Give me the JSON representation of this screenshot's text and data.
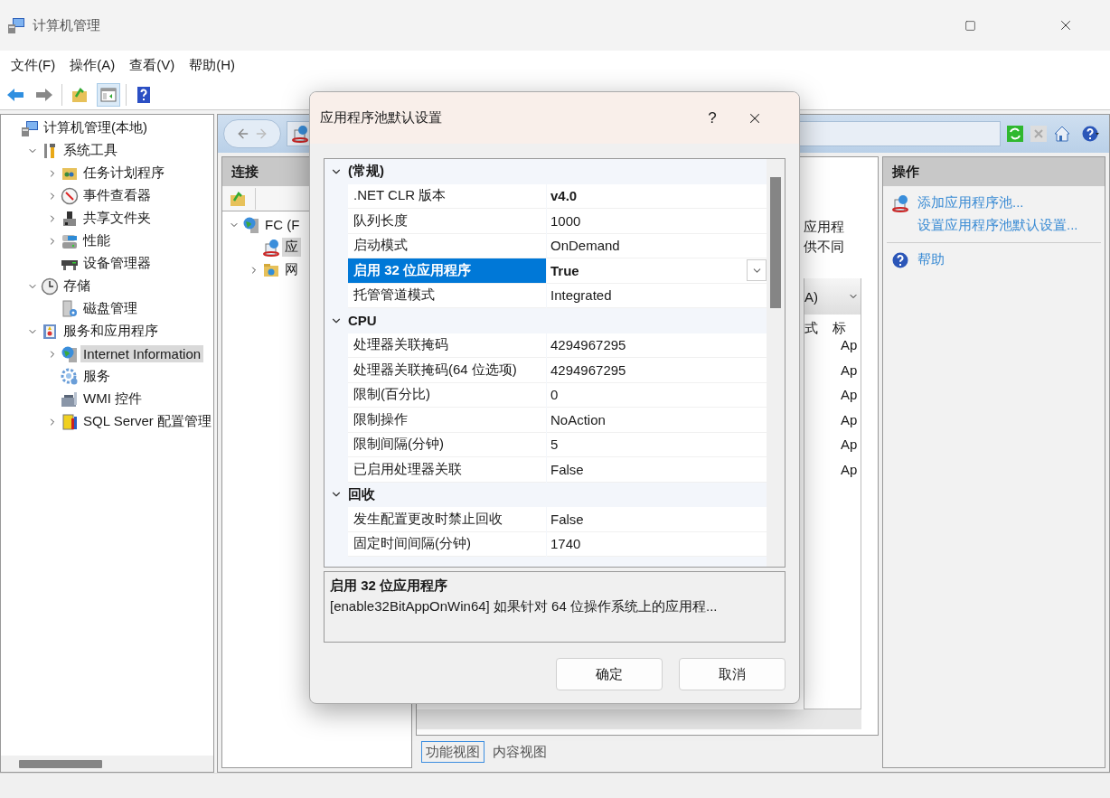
{
  "window": {
    "title": "计算机管理"
  },
  "menu": [
    "文件(F)",
    "操作(A)",
    "查看(V)",
    "帮助(H)"
  ],
  "tree": [
    {
      "label": "计算机管理(本地)",
      "selected": false,
      "children": [
        {
          "label": "系统工具",
          "selected": false,
          "expanded": true,
          "children": [
            {
              "label": "任务计划程序",
              "selected": false,
              "expanded": false
            },
            {
              "label": "事件查看器",
              "selected": false,
              "expanded": false
            },
            {
              "label": "共享文件夹",
              "selected": false,
              "expanded": false
            },
            {
              "label": "性能",
              "selected": false,
              "expanded": false
            },
            {
              "label": "设备管理器",
              "selected": false
            }
          ]
        },
        {
          "label": "存储",
          "selected": false,
          "expanded": true,
          "children": [
            {
              "label": "磁盘管理",
              "selected": false
            }
          ]
        },
        {
          "label": "服务和应用程序",
          "selected": false,
          "expanded": true,
          "children": [
            {
              "label": "Internet Information",
              "selected": true,
              "expanded": false
            },
            {
              "label": "服务",
              "selected": false
            },
            {
              "label": "WMI 控件",
              "selected": false
            },
            {
              "label": "SQL Server 配置管理",
              "selected": false,
              "expanded": false
            }
          ]
        }
      ]
    }
  ],
  "connections": {
    "title": "连接",
    "tree": [
      {
        "label": "FC (F",
        "selected": false,
        "expanded": true,
        "children": [
          {
            "label": "应",
            "selected": true
          },
          {
            "label": "网",
            "selected": false,
            "expanded": false
          }
        ]
      }
    ]
  },
  "center": {
    "description_fragments": [
      "应用程",
      "供不同"
    ],
    "column_headers": [
      "A)",
      "式",
      "标"
    ],
    "rows": [
      "Ap",
      "Ap",
      "Ap",
      "Ap",
      "Ap",
      "Ap"
    ],
    "view_tabs": [
      {
        "label": "功能视图",
        "selected": true
      },
      {
        "label": "内容视图",
        "selected": false
      }
    ]
  },
  "actions": {
    "title": "操作",
    "groups": [
      [
        "添加应用程序池...",
        "设置应用程序池默认设置..."
      ],
      [
        "帮助"
      ]
    ]
  },
  "dialog": {
    "title": "应用程序池默认设置",
    "help_button": "?",
    "categories": [
      {
        "name": "(常规)",
        "expanded": true,
        "rows": [
          {
            "name": ".NET CLR 版本",
            "value": "v4.0",
            "modified": true,
            "selected": false
          },
          {
            "name": "队列长度",
            "value": "1000",
            "modified": false,
            "selected": false
          },
          {
            "name": "启动模式",
            "value": "OnDemand",
            "modified": false,
            "selected": false
          },
          {
            "name": "启用 32 位应用程序",
            "value": "True",
            "modified": true,
            "selected": true
          },
          {
            "name": "托管管道模式",
            "value": "Integrated",
            "modified": false,
            "selected": false
          }
        ]
      },
      {
        "name": "CPU",
        "expanded": true,
        "rows": [
          {
            "name": "处理器关联掩码",
            "value": "4294967295",
            "modified": false,
            "selected": false
          },
          {
            "name": "处理器关联掩码(64 位选项)",
            "value": "4294967295",
            "modified": false,
            "selected": false
          },
          {
            "name": "限制(百分比)",
            "value": "0",
            "modified": false,
            "selected": false
          },
          {
            "name": "限制操作",
            "value": "NoAction",
            "modified": false,
            "selected": false
          },
          {
            "name": "限制间隔(分钟)",
            "value": "5",
            "modified": false,
            "selected": false
          },
          {
            "name": "已启用处理器关联",
            "value": "False",
            "modified": false,
            "selected": false
          }
        ]
      },
      {
        "name": "回收",
        "expanded": true,
        "rows": [
          {
            "name": "发生配置更改时禁止回收",
            "value": "False",
            "modified": false,
            "selected": false
          },
          {
            "name": "固定时间间隔(分钟)",
            "value": "1740",
            "modified": false,
            "selected": false
          }
        ]
      }
    ],
    "description": {
      "title": "启用 32 位应用程序",
      "text": "[enable32BitAppOnWin64] 如果针对 64 位操作系统上的应用程..."
    },
    "buttons": [
      "确定",
      "取消"
    ]
  }
}
